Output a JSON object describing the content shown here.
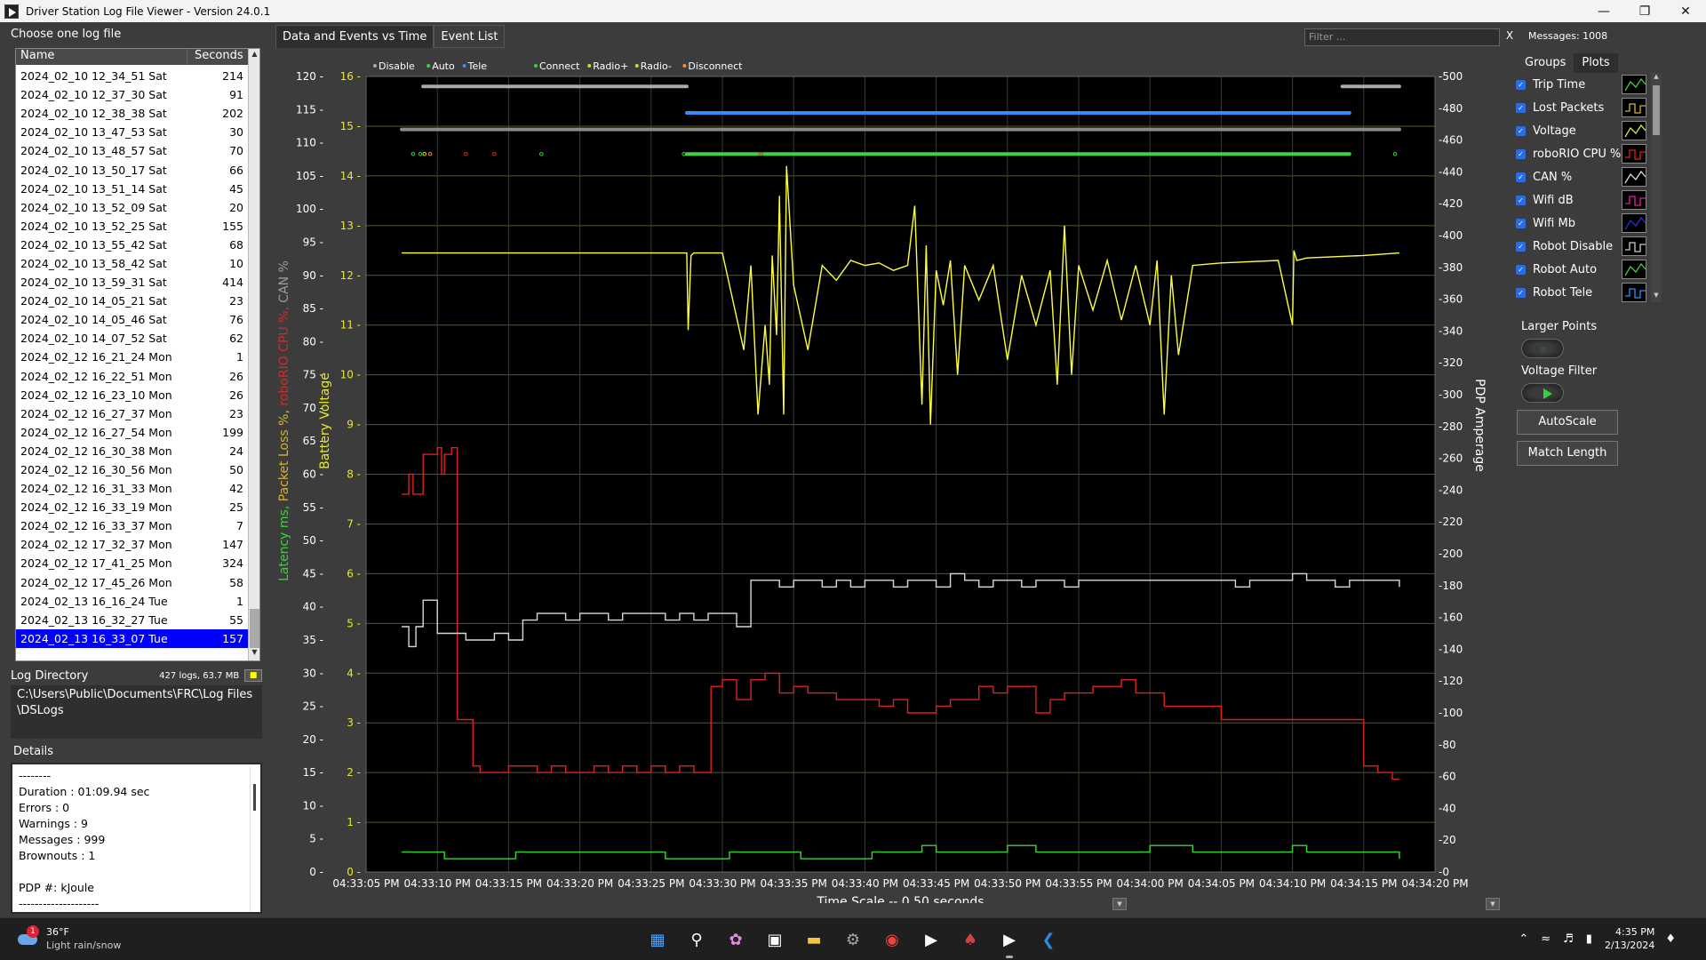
{
  "window": {
    "title": "Driver Station Log File Viewer - Version 24.0.1"
  },
  "left": {
    "choose_label": "Choose one log file",
    "columns": {
      "name": "Name",
      "seconds": "Seconds"
    },
    "files": [
      {
        "name": "2024_02_10 12_34_51 Sat",
        "seconds": "214"
      },
      {
        "name": "2024_02_10 12_37_30 Sat",
        "seconds": "91"
      },
      {
        "name": "2024_02_10 12_38_38 Sat",
        "seconds": "202"
      },
      {
        "name": "2024_02_10 13_47_53 Sat",
        "seconds": "30"
      },
      {
        "name": "2024_02_10 13_48_57 Sat",
        "seconds": "70"
      },
      {
        "name": "2024_02_10 13_50_17 Sat",
        "seconds": "66"
      },
      {
        "name": "2024_02_10 13_51_14 Sat",
        "seconds": "45"
      },
      {
        "name": "2024_02_10 13_52_09 Sat",
        "seconds": "20"
      },
      {
        "name": "2024_02_10 13_52_25 Sat",
        "seconds": "155"
      },
      {
        "name": "2024_02_10 13_55_42 Sat",
        "seconds": "68"
      },
      {
        "name": "2024_02_10 13_58_42 Sat",
        "seconds": "10"
      },
      {
        "name": "2024_02_10 13_59_31 Sat",
        "seconds": "414"
      },
      {
        "name": "2024_02_10 14_05_21 Sat",
        "seconds": "23"
      },
      {
        "name": "2024_02_10 14_05_46 Sat",
        "seconds": "76"
      },
      {
        "name": "2024_02_10 14_07_52 Sat",
        "seconds": "62"
      },
      {
        "name": "2024_02_12 16_21_24 Mon",
        "seconds": "1"
      },
      {
        "name": "2024_02_12 16_22_51 Mon",
        "seconds": "26"
      },
      {
        "name": "2024_02_12 16_23_10 Mon",
        "seconds": "26"
      },
      {
        "name": "2024_02_12 16_27_37 Mon",
        "seconds": "23"
      },
      {
        "name": "2024_02_12 16_27_54 Mon",
        "seconds": "199"
      },
      {
        "name": "2024_02_12 16_30_38 Mon",
        "seconds": "24"
      },
      {
        "name": "2024_02_12 16_30_56 Mon",
        "seconds": "50"
      },
      {
        "name": "2024_02_12 16_31_33 Mon",
        "seconds": "42"
      },
      {
        "name": "2024_02_12 16_33_19 Mon",
        "seconds": "25"
      },
      {
        "name": "2024_02_12 16_33_37 Mon",
        "seconds": "7"
      },
      {
        "name": "2024_02_12 17_32_37 Mon",
        "seconds": "147"
      },
      {
        "name": "2024_02_12 17_41_25 Mon",
        "seconds": "324"
      },
      {
        "name": "2024_02_12 17_45_26 Mon",
        "seconds": "58"
      },
      {
        "name": "2024_02_13 16_16_24 Tue",
        "seconds": "1"
      },
      {
        "name": "2024_02_13 16_32_27 Tue",
        "seconds": "55"
      },
      {
        "name": "2024_02_13 16_33_07 Tue",
        "seconds": "157"
      }
    ],
    "selected_index": 30,
    "log_directory_label": "Log Directory",
    "log_directory_info": "427 logs, 63.7 MB",
    "log_directory_path": "C:\\Users\\Public\\Documents\\FRC\\Log Files\\DSLogs",
    "details_label": "Details",
    "details_lines": [
      "--------",
      "Duration : 01:09.94 sec",
      "Errors : 0",
      "Warnings : 9",
      "Messages : 999",
      "Brownouts : 1",
      "",
      "PDP #:   kJoule",
      "--------------------"
    ]
  },
  "center": {
    "tabs": [
      {
        "label": "Data and Events vs Time"
      },
      {
        "label": "Event List"
      }
    ],
    "active_tab": 0,
    "filter_placeholder": "Filter ...",
    "filter_clear": "X",
    "messages": "Messages: 1008"
  },
  "chart_data": {
    "type": "line",
    "legend": [
      {
        "label": "Disable",
        "color": "#aaaaaa"
      },
      {
        "label": "Auto",
        "color": "#3ad43a"
      },
      {
        "label": "Tele",
        "color": "#2f8fff"
      },
      {
        "label": "Connect",
        "color": "#3ad43a"
      },
      {
        "label": "Radio+",
        "color": "#d7d72a"
      },
      {
        "label": "Radio-",
        "color": "#d7d72a"
      },
      {
        "label": "Disconnect",
        "color": "#ff8c2a"
      }
    ],
    "xlabel": "Time Scale -- 0.50 seconds",
    "x_ticks": [
      "04:33:05 PM",
      "04:33:10 PM",
      "04:33:15 PM",
      "04:33:20 PM",
      "04:33:25 PM",
      "04:33:30 PM",
      "04:33:35 PM",
      "04:33:40 PM",
      "04:33:45 PM",
      "04:33:50 PM",
      "04:33:55 PM",
      "04:34:00 PM",
      "04:34:05 PM",
      "04:34:10 PM",
      "04:34:15 PM",
      "04:34:20 PM"
    ],
    "xlim": [
      0,
      75
    ],
    "left_axis": {
      "label_parts": [
        {
          "text": "Latency ms, ",
          "color": "#3ad43a"
        },
        {
          "text": "Packet Loss %, ",
          "color": "#d7b22a"
        },
        {
          "text": "roboRIO CPU %, ",
          "color": "#d42a2a"
        },
        {
          "text": "CAN %",
          "color": "#9a9a9a"
        }
      ],
      "ticks": [
        "0",
        "5",
        "10",
        "15",
        "20",
        "25",
        "30",
        "35",
        "40",
        "45",
        "50",
        "55",
        "60",
        "65",
        "70",
        "75",
        "80",
        "85",
        "90",
        "95",
        "100",
        "105",
        "110",
        "115",
        "120"
      ],
      "ylim": [
        0,
        120
      ]
    },
    "voltage_axis": {
      "label": "Battery Voltage",
      "color": "#e8e82a",
      "ticks": [
        "0",
        "1",
        "2",
        "3",
        "4",
        "5",
        "6",
        "7",
        "8",
        "9",
        "10",
        "11",
        "12",
        "13",
        "14",
        "15",
        "16"
      ],
      "ylim": [
        0,
        16
      ]
    },
    "right_axis": {
      "label": "PDP Amperage",
      "ticks": [
        "0",
        "20",
        "40",
        "60",
        "80",
        "100",
        "120",
        "140",
        "160",
        "180",
        "200",
        "220",
        "240",
        "260",
        "280",
        "300",
        "320",
        "340",
        "360",
        "380",
        "400",
        "420",
        "440",
        "460",
        "480",
        "500"
      ],
      "ylim": [
        0,
        500
      ]
    },
    "series": [
      {
        "name": "Voltage",
        "color": "#ffff40",
        "axis": "voltage",
        "x": [
          2.5,
          5,
          10,
          15,
          20,
          22.5,
          22.6,
          22.8,
          23,
          25,
          26.5,
          27,
          27.5,
          28,
          28.3,
          28.5,
          28.8,
          29,
          29.3,
          29.5,
          30,
          31,
          32,
          33,
          34,
          35,
          36,
          37,
          38,
          38.5,
          39,
          39.3,
          39.6,
          40,
          40.5,
          41,
          41.5,
          42,
          43,
          44,
          45,
          46,
          47,
          48,
          48.5,
          49,
          49.5,
          50,
          51,
          52,
          53,
          54,
          55,
          55.5,
          56,
          56.5,
          57,
          58,
          60,
          64,
          65,
          65.1,
          65.3,
          66,
          70,
          72.5
        ],
        "values": [
          12.45,
          12.45,
          12.45,
          12.45,
          12.45,
          12.45,
          10.9,
          12.4,
          12.45,
          12.45,
          10.5,
          12.2,
          9.2,
          11.0,
          9.8,
          12.4,
          10.8,
          13.6,
          9.2,
          14.2,
          11.8,
          10.5,
          12.2,
          11.9,
          12.3,
          12.2,
          12.25,
          12.1,
          12.2,
          13.4,
          9.4,
          12.6,
          9.0,
          12.1,
          11.4,
          12.3,
          10.0,
          12.2,
          11.5,
          12.2,
          10.3,
          12.0,
          11.0,
          12.1,
          9.8,
          13.0,
          10.0,
          12.2,
          11.3,
          12.3,
          11.1,
          12.2,
          11.0,
          12.3,
          9.2,
          12.0,
          10.4,
          12.2,
          12.25,
          12.3,
          11.0,
          12.5,
          12.3,
          12.35,
          12.4,
          12.45
        ]
      },
      {
        "name": "roboRIO CPU %",
        "color": "#e02020",
        "axis": "left",
        "x": [
          2.5,
          3,
          3.3,
          4,
          5,
          5.3,
          5.5,
          6,
          6.4,
          7.5,
          8,
          9,
          10,
          11,
          12,
          13,
          14,
          15,
          16,
          17,
          18,
          19,
          20,
          21,
          22,
          23,
          24,
          24.2,
          25,
          26,
          27,
          28,
          29,
          30,
          31,
          32,
          33,
          34,
          35,
          36,
          37,
          38,
          39,
          40,
          41,
          42,
          43,
          44,
          45,
          46,
          47,
          48,
          49,
          50,
          51,
          52,
          53,
          54,
          55,
          56,
          57,
          58,
          60,
          62,
          64,
          65,
          66,
          69.5,
          70,
          71,
          72,
          72.5
        ],
        "values": [
          57,
          60,
          57,
          63,
          64,
          60,
          63,
          64,
          23,
          16,
          15,
          15,
          16,
          16,
          15,
          16,
          15,
          15,
          16,
          15,
          16,
          15,
          16,
          15,
          16,
          15,
          15,
          28,
          29,
          26,
          29,
          30,
          27,
          28,
          27,
          27,
          26,
          26,
          26,
          25,
          26,
          24,
          24,
          25,
          26,
          26,
          28,
          27,
          28,
          28,
          24,
          26,
          27,
          27,
          28,
          28,
          29,
          27,
          27,
          25,
          25,
          25,
          23,
          23,
          23,
          23,
          23,
          23,
          16,
          15,
          14,
          14
        ]
      },
      {
        "name": "CAN %",
        "color": "#d8d8d8",
        "axis": "left",
        "x": [
          2.5,
          3,
          3.5,
          4,
          5,
          6,
          7,
          8,
          9,
          10,
          11,
          12,
          13,
          14,
          15,
          16,
          17,
          18,
          19,
          20,
          21,
          22,
          22.5,
          23,
          24,
          25,
          26,
          27,
          28,
          29,
          30,
          31,
          32,
          33,
          34,
          35,
          36,
          37,
          38,
          39,
          40,
          41,
          42,
          43,
          44,
          45,
          46,
          47,
          48,
          49,
          50,
          51,
          52,
          53,
          54,
          55,
          56,
          57,
          58,
          59,
          60,
          61,
          62,
          63,
          64,
          65,
          66,
          67,
          68,
          69,
          70,
          71,
          72,
          72.5
        ],
        "values": [
          37,
          34,
          37,
          41,
          36,
          36,
          35,
          35,
          36,
          35,
          38,
          39,
          39,
          38,
          39,
          39,
          38,
          39,
          39,
          39,
          38,
          39,
          39,
          38,
          39,
          39,
          37,
          44,
          44,
          43,
          44,
          44,
          43,
          44,
          43,
          44,
          44,
          43,
          44,
          44,
          43,
          45,
          44,
          43,
          44,
          44,
          43,
          44,
          44,
          43,
          44,
          44,
          44,
          44,
          44,
          44,
          44,
          44,
          44,
          44,
          44,
          43,
          44,
          44,
          44,
          45,
          44,
          44,
          43,
          44,
          44,
          44,
          44,
          43
        ]
      },
      {
        "name": "Trip Time",
        "color": "#3ad43a",
        "axis": "left",
        "x": [
          2.5,
          5,
          5.5,
          10,
          10.5,
          20,
          21,
          25,
          25.5,
          30,
          30.5,
          35,
          35.5,
          37,
          39,
          40,
          42,
          45,
          47,
          50,
          52,
          55,
          58,
          60,
          62,
          65,
          66,
          68,
          70,
          72.5
        ],
        "values": [
          3,
          3,
          2,
          2,
          3,
          3,
          2,
          2,
          3,
          3,
          2,
          2,
          3,
          3,
          4,
          3,
          3,
          4,
          3,
          3,
          3,
          4,
          3,
          3,
          3,
          4,
          3,
          3,
          3,
          2
        ]
      }
    ],
    "mode_bars": [
      {
        "name": "Disable top",
        "color": "#aaaaaa",
        "x0": 4,
        "x1": 22.5,
        "level": 118.5
      },
      {
        "name": "Disable top end",
        "color": "#aaaaaa",
        "x0": 68.5,
        "x1": 72.5,
        "level": 118.5
      },
      {
        "name": "Tele",
        "color": "#2f8fff",
        "x0": 22.5,
        "x1": 69,
        "level": 114.5
      },
      {
        "name": "Disable mid",
        "color": "#8a8a8a",
        "x0": 2.5,
        "x1": 72.5,
        "level": 112
      },
      {
        "name": "Connect",
        "color": "#3ad43a",
        "x0": 22.5,
        "x1": 69,
        "level": 108.3
      }
    ],
    "event_markers": [
      {
        "x": 3.3,
        "color": "#3ad43a"
      },
      {
        "x": 3.8,
        "color": "#3ad43a"
      },
      {
        "x": 4.1,
        "color": "#d7d72a"
      },
      {
        "x": 4.5,
        "color": "#ff8c2a"
      },
      {
        "x": 7.0,
        "color": "#d42a2a"
      },
      {
        "x": 9.0,
        "color": "#d42a2a"
      },
      {
        "x": 12.3,
        "color": "#3ad43a"
      },
      {
        "x": 22.3,
        "color": "#3ad43a"
      },
      {
        "x": 27.7,
        "color": "#d42a2a"
      },
      {
        "x": 72.2,
        "color": "#3ad43a"
      }
    ]
  },
  "right": {
    "tabs": [
      {
        "label": "Groups"
      },
      {
        "label": "Plots"
      }
    ],
    "active_tab": 1,
    "plots": [
      {
        "label": "Trip Time",
        "color": "#3ad43a"
      },
      {
        "label": "Lost Packets",
        "color": "#d7b22a"
      },
      {
        "label": "Voltage",
        "color": "#e8e82a"
      },
      {
        "label": "roboRIO CPU %",
        "color": "#e02020"
      },
      {
        "label": "CAN %",
        "color": "#dddddd"
      },
      {
        "label": "Wifi dB",
        "color": "#e0209a"
      },
      {
        "label": "Wifi Mb",
        "color": "#2030e0"
      },
      {
        "label": "Robot Disable",
        "color": "#cccccc"
      },
      {
        "label": "Robot Auto",
        "color": "#3ad43a"
      },
      {
        "label": "Robot Tele",
        "color": "#2f8fff"
      }
    ],
    "larger_points_label": "Larger Points",
    "voltage_filter_label": "Voltage Filter",
    "autoscale_label": "AutoScale",
    "match_length_label": "Match Length"
  },
  "taskbar": {
    "weather_temp": "36°F",
    "weather_desc": "Light rain/snow",
    "weather_badge": "1",
    "time": "4:35 PM",
    "date": "2/13/2024"
  }
}
